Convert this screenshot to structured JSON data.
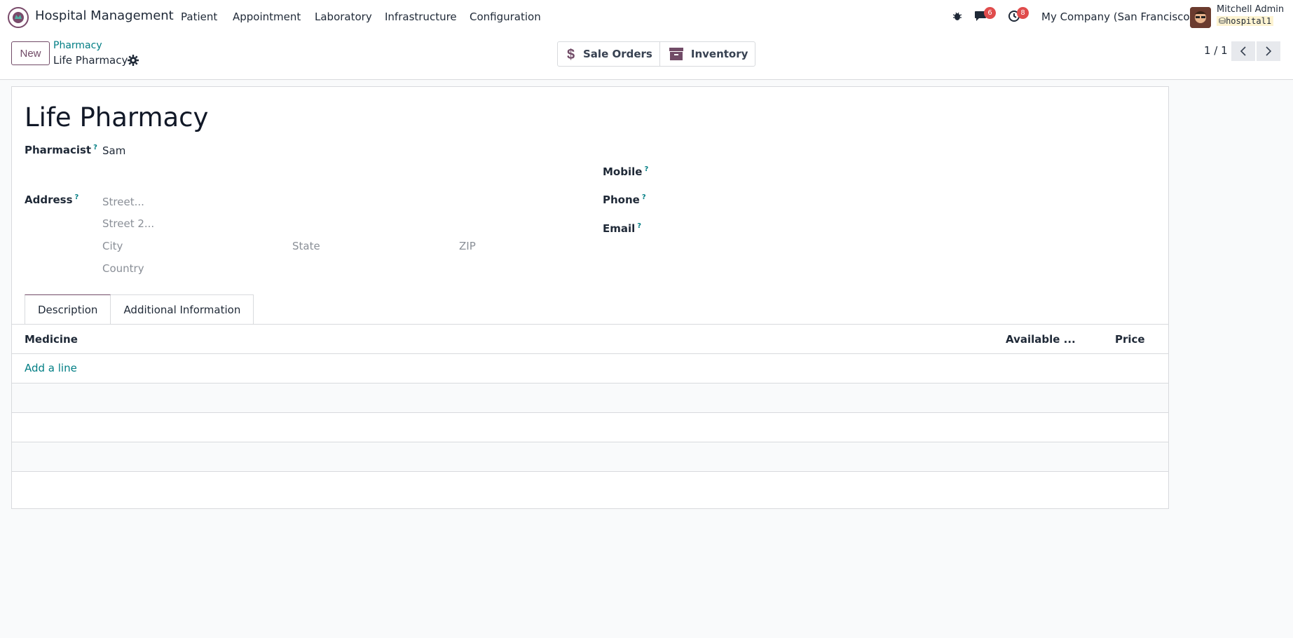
{
  "app": {
    "name": "Hospital Management"
  },
  "menu": [
    "Patient",
    "Appointment",
    "Laboratory",
    "Infrastructure",
    "Configuration"
  ],
  "systray": {
    "chat_count": "6",
    "activity_count": "8",
    "company": "My Company (San Francisco)",
    "user": "Mitchell Admin",
    "database": "hospital1"
  },
  "controls": {
    "new_label": "New",
    "breadcrumb_parent": "Pharmacy",
    "breadcrumb_current": "Life Pharmacy",
    "smart_buttons": [
      "Sale Orders",
      "Inventory"
    ],
    "pager": "1 / 1"
  },
  "form": {
    "title": "Life Pharmacy",
    "pharmacist_label": "Pharmacist",
    "pharmacist_value": "Sam",
    "address_label": "Address",
    "street_ph": "Street...",
    "street2_ph": "Street 2...",
    "city_ph": "City",
    "state_ph": "State",
    "zip_ph": "ZIP",
    "country_ph": "Country",
    "mobile_label": "Mobile",
    "phone_label": "Phone",
    "email_label": "Email",
    "help_mark": "?"
  },
  "tabs": [
    "Description",
    "Additional Information"
  ],
  "table": {
    "columns": [
      "Medicine",
      "Available ...",
      "Price"
    ],
    "add_line": "Add a line"
  },
  "colors": {
    "brand": "#714b67",
    "link": "#017e84",
    "badge": "#e04c4c"
  }
}
